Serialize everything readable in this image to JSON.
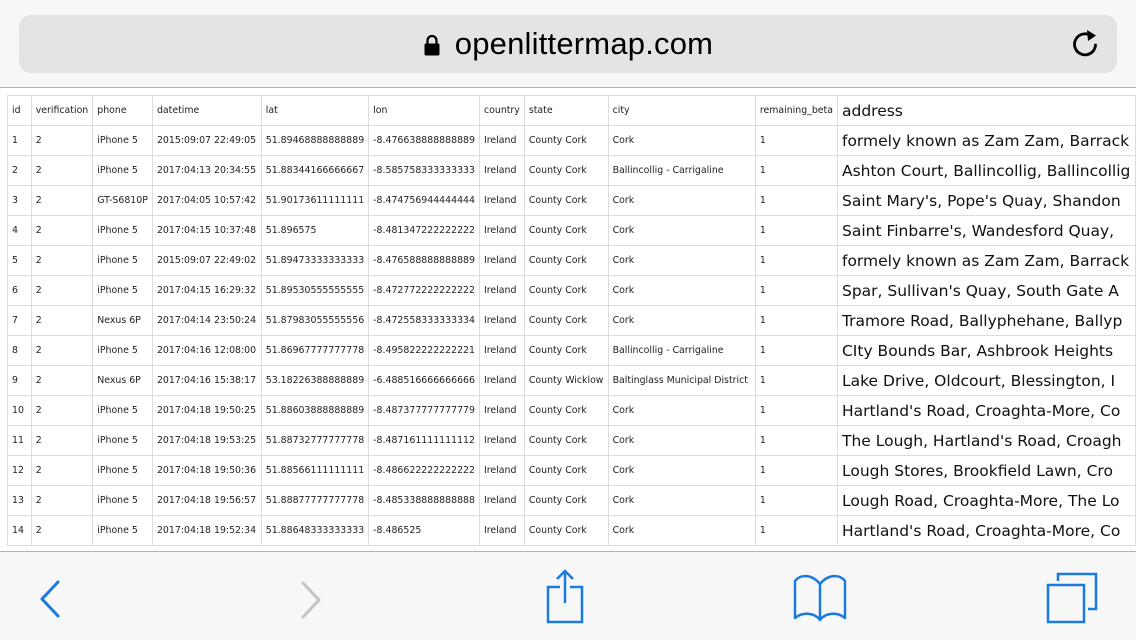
{
  "browser": {
    "url": "openlittermap.com",
    "icons": {
      "lock": "lock-icon",
      "reload": "reload-icon",
      "back": "chevron-left-icon",
      "forward": "chevron-right-icon",
      "share": "share-icon",
      "bookmarks": "book-icon",
      "tabs": "tabs-icon"
    },
    "accent_color": "#1a7ae0",
    "disabled_color": "#c4c4c4"
  },
  "table": {
    "columns": [
      "id",
      "verification",
      "phone",
      "datetime",
      "lat",
      "lon",
      "country",
      "state",
      "city",
      "remaining_beta",
      "address"
    ],
    "rows": [
      [
        "1",
        "2",
        "iPhone 5",
        "2015:09:07 22:49:05",
        "51.89468888888889",
        "-8.476638888888889",
        "Ireland",
        "County Cork",
        "Cork",
        "1",
        "formely known as Zam Zam, Barrack"
      ],
      [
        "2",
        "2",
        "iPhone 5",
        "2017:04:13 20:34:55",
        "51.88344166666667",
        "-8.585758333333333",
        "Ireland",
        "County Cork",
        "Ballincollig - Carrigaline",
        "1",
        "Ashton Court, Ballincollig, Ballincollig"
      ],
      [
        "3",
        "2",
        "GT-S6810P",
        "2017:04:05 10:57:42",
        "51.90173611111111",
        "-8.474756944444444",
        "Ireland",
        "County Cork",
        "Cork",
        "1",
        "Saint Mary's, Pope's Quay, Shandon"
      ],
      [
        "4",
        "2",
        "iPhone 5",
        "2017:04:15 10:37:48",
        "51.896575",
        "-8.481347222222222",
        "Ireland",
        "County Cork",
        "Cork",
        "1",
        "Saint Finbarre's, Wandesford Quay,"
      ],
      [
        "5",
        "2",
        "iPhone 5",
        "2015:09:07 22:49:02",
        "51.89473333333333",
        "-8.476588888888889",
        "Ireland",
        "County Cork",
        "Cork",
        "1",
        "formely known as Zam Zam, Barrack"
      ],
      [
        "6",
        "2",
        "iPhone 5",
        "2017:04:15 16:29:32",
        "51.89530555555555",
        "-8.472772222222222",
        "Ireland",
        "County Cork",
        "Cork",
        "1",
        "Spar, Sullivan's Quay, South Gate A"
      ],
      [
        "7",
        "2",
        "Nexus 6P",
        "2017:04:14 23:50:24",
        "51.87983055555556",
        "-8.472558333333334",
        "Ireland",
        "County Cork",
        "Cork",
        "1",
        "Tramore Road, Ballyphehane, Ballyp"
      ],
      [
        "8",
        "2",
        "iPhone 5",
        "2017:04:16 12:08:00",
        "51.86967777777778",
        "-8.495822222222221",
        "Ireland",
        "County Cork",
        "Ballincollig - Carrigaline",
        "1",
        "CIty Bounds Bar, Ashbrook Heights"
      ],
      [
        "9",
        "2",
        "Nexus 6P",
        "2017:04:16 15:38:17",
        "53.18226388888889",
        "-6.488516666666666",
        "Ireland",
        "County Wicklow",
        "Baltinglass Municipal District",
        "1",
        "Lake Drive, Oldcourt, Blessington, I"
      ],
      [
        "10",
        "2",
        "iPhone 5",
        "2017:04:18 19:50:25",
        "51.88603888888889",
        "-8.487377777777779",
        "Ireland",
        "County Cork",
        "Cork",
        "1",
        "Hartland's Road, Croaghta-More, Co"
      ],
      [
        "11",
        "2",
        "iPhone 5",
        "2017:04:18 19:53:25",
        "51.88732777777778",
        "-8.487161111111112",
        "Ireland",
        "County Cork",
        "Cork",
        "1",
        "The Lough, Hartland's Road, Croagh"
      ],
      [
        "12",
        "2",
        "iPhone 5",
        "2017:04:18 19:50:36",
        "51.88566111111111",
        "-8.486622222222222",
        "Ireland",
        "County Cork",
        "Cork",
        "1",
        "Lough Stores, Brookfield Lawn, Cro"
      ],
      [
        "13",
        "2",
        "iPhone 5",
        "2017:04:18 19:56:57",
        "51.88877777777778",
        "-8.485338888888888",
        "Ireland",
        "County Cork",
        "Cork",
        "1",
        "Lough Road, Croaghta-More, The Lo"
      ],
      [
        "14",
        "2",
        "iPhone 5",
        "2017:04:18 19:52:34",
        "51.88648333333333",
        "-8.486525",
        "Ireland",
        "County Cork",
        "Cork",
        "1",
        "Hartland's Road, Croaghta-More, Co"
      ]
    ]
  }
}
